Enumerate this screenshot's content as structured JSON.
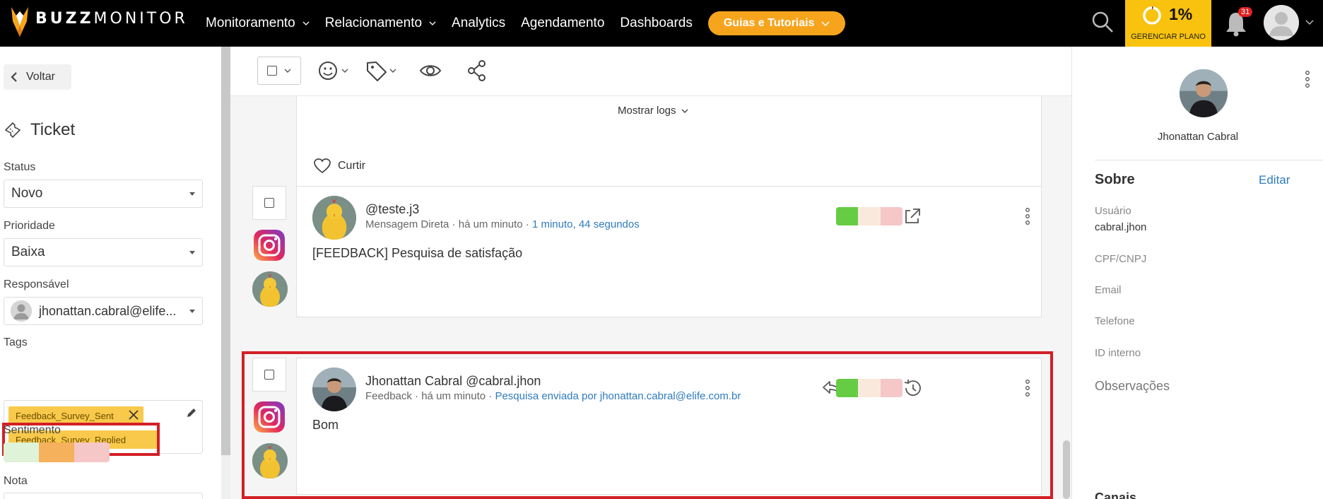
{
  "brand": {
    "bold": "BUZZ",
    "rest": "MONITOR"
  },
  "nav": {
    "items": [
      {
        "label": "Monitoramento",
        "has_dropdown": true
      },
      {
        "label": "Relacionamento",
        "has_dropdown": true
      },
      {
        "label": "Analytics",
        "has_dropdown": false
      },
      {
        "label": "Agendamento",
        "has_dropdown": false
      },
      {
        "label": "Dashboards",
        "has_dropdown": false
      }
    ],
    "guide_button": "Guias e Tutoriais",
    "plan_percent": "1%",
    "plan_percent_value": 0.01,
    "plan_label": "GERENCIAR PLANO",
    "notification_count": "31"
  },
  "left_panel": {
    "back_label": "Voltar",
    "title": "Ticket",
    "status": {
      "label": "Status",
      "value": "Novo"
    },
    "priority": {
      "label": "Prioridade",
      "value": "Baixa"
    },
    "owner": {
      "label": "Responsável",
      "value": "jhonattan.cabral@elife..."
    },
    "tags": {
      "label": "Tags",
      "items": [
        "Feedback_Survey_Sent",
        "Feedback_Survey_Replied"
      ]
    },
    "sentiment_label": "Sentimento",
    "note_label": "Nota"
  },
  "toolbar": {
    "icons": [
      "checkbox-icon",
      "emoji-icon",
      "tag-icon",
      "eye-icon",
      "share-icon"
    ]
  },
  "feed": {
    "previous": {
      "show_logs": "Mostrar logs",
      "like_label": "Curtir"
    },
    "messages": [
      {
        "author": "@teste.j3",
        "channel": "Mensagem Direta",
        "time": "há um minuto",
        "extra": "1 minuto, 44 segundos",
        "body": "[FEEDBACK] Pesquisa de satisfação"
      },
      {
        "author": "Jhonattan Cabral @cabral.jhon",
        "channel": "Feedback",
        "time": "há um minuto",
        "extra": "Pesquisa enviada por jhonattan.cabral@elife.com.br",
        "body": "Bom"
      }
    ]
  },
  "right_panel": {
    "name": "Jhonattan Cabral",
    "section_title": "Sobre",
    "edit_label": "Editar",
    "fields": [
      {
        "label": "Usuário",
        "value": "cabral.jhon"
      },
      {
        "label": "CPF/CNPJ",
        "value": ""
      },
      {
        "label": "Email",
        "value": ""
      },
      {
        "label": "Telefone",
        "value": ""
      },
      {
        "label": "ID interno",
        "value": ""
      }
    ],
    "notes_label": "Observações",
    "bottom_partial": "Canais"
  },
  "colors": {
    "accent_orange": "#f7a41d",
    "plan_yellow": "#f9c20e",
    "tag_yellow": "#f8c94a",
    "link_blue": "#2f7bbd",
    "highlight_red": "#d31f26",
    "sentiment_positive": "#66cc44",
    "sentiment_neutral": "#f9e9dc",
    "sentiment_negative": "#f6c7c7"
  }
}
